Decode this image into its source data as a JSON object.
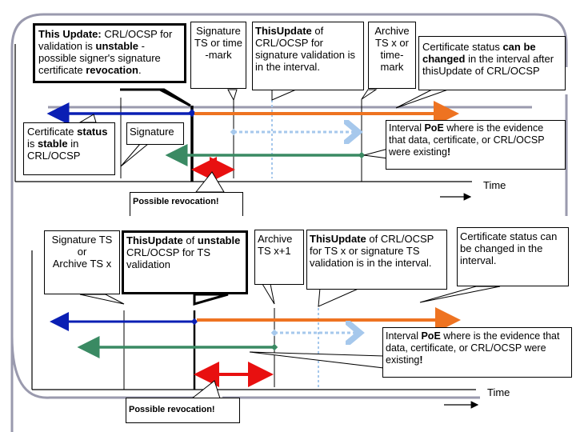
{
  "colors": {
    "frame": "#9a9aae",
    "blue": "#0a1fb4",
    "orange": "#ee7321",
    "lightblue": "#a6c8ec",
    "green": "#3a8a63",
    "red": "#e81010",
    "black": "#000000"
  },
  "top_panel": {
    "callouts": {
      "thisupdate_unstable": {
        "bold1": "This Update:",
        "text1": " CRL/OCSP for validation is ",
        "bold2": "unstable",
        "text2": " - possible signer's signature certificate ",
        "bold3": "revocation",
        "text3": "."
      },
      "signature_ts": {
        "text": "Signature\nTS or time\n-mark"
      },
      "thisupdate_interval": {
        "bold1": "ThisUpdate",
        "text1": " of CRL/OCSP for signature validation is in the interval."
      },
      "archive_ts": {
        "text": "Archive\nTS x or\ntime-\nmark"
      },
      "status_changed": {
        "text1": "Certificate status ",
        "bold1": "can be changed",
        "text2": " in the interval after thisUpdate of CRL/OCSP"
      },
      "status_stable": {
        "text1": "Certificate ",
        "bold1": "status",
        "text2": " is ",
        "bold2": "stable",
        "text3": " in CRL/OCSP"
      },
      "signature": {
        "text": "Signature"
      },
      "poe": {
        "text1": "Interval ",
        "bold1": "PoE",
        "text2": " where is the evidence that data, certificate, or CRL/OCSP were existing",
        "bold2": "!"
      },
      "possible_revocation": {
        "text": "Possible revocation!"
      }
    },
    "time_label": "Time"
  },
  "bottom_panel": {
    "callouts": {
      "signature_or_archive": {
        "text": "Signature TS\nor\nArchive TS x"
      },
      "thisupdate_unstable_ts": {
        "bold1": "ThisUpdate",
        "text1": " of ",
        "bold2": "unstable",
        "text2": " CRL/OCSP for TS validation"
      },
      "archive_ts_x1": {
        "text": "Archive\nTS x+1"
      },
      "thisupdate_interval": {
        "bold1": "ThisUpdate",
        "text1": " of CRL/OCSP for TS x or signature TS validation is in the interval."
      },
      "status_changed": {
        "text": "Certificate status can be changed in the interval."
      },
      "poe": {
        "text1": "Interval ",
        "bold1": "PoE",
        "text2": " where is the evidence that data, certificate, or CRL/OCSP were existing",
        "bold2": "!"
      },
      "possible_revocation": {
        "text": "Possible revocation!"
      }
    },
    "time_label": "Time"
  }
}
